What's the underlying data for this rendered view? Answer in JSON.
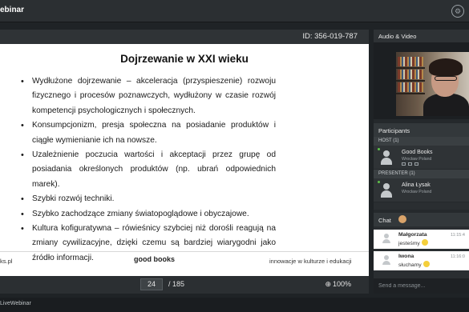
{
  "app": {
    "title": "ebinar",
    "footer_brand": "LiveWebinar"
  },
  "stage": {
    "room_id": "ID: 356-019-787",
    "slide": {
      "title": "Dojrzewanie w XXI wieku",
      "bullets": [
        "Wydłużone dojrzewanie – akceleracja (przyspieszenie) rozwoju fizycznego i procesów poznawczych, wydłużony w czasie rozwój kompetencji psychologicznych i społecznych.",
        "Konsumpcjonizm, presja społeczna na posiadanie produktów i ciągłe wymienianie ich na nowsze.",
        "Uzależnienie poczucia wartości i akceptacji przez grupę od posiadania określonych produktów (np. ubrań odpowiednich marek).",
        "Szybki rozwój techniki.",
        "Szybko zachodzące zmiany światopoglądowe i obyczajowe.",
        "Kultura kofiguratywna – rówieśnicy szybciej niż dorośli reagują na zmiany cywilizacyjne, dzięki czemu są bardziej wiarygodni jako źródło informacji."
      ],
      "footer_left": "ks.pl",
      "footer_logo": "good books",
      "footer_right": "innowacje w kulturze i edukacji"
    },
    "pager": {
      "current": "24",
      "total": "/ 185",
      "zoom": "100%"
    }
  },
  "sidebar": {
    "av_title": "Audio & Video",
    "participants_title": "Participants",
    "host_group": "HOST (1)",
    "host": {
      "name": "Good Books",
      "location": "Wrocław Poland"
    },
    "presenter_group": "PRESENTER (1)",
    "presenter": {
      "name": "Alina Łysak",
      "location": "Wrocław Poland"
    },
    "chat_title": "Chat",
    "messages": [
      {
        "name": "Małgorzata",
        "text": "jesteśmy",
        "time": "11:15:4"
      },
      {
        "name": "Iwona",
        "text": "słuchamy",
        "time": "11:16:0"
      }
    ],
    "chat_placeholder": "Send a message..."
  },
  "colors": {
    "background": "#1f2326",
    "panel": "#25292c",
    "online": "#5fc04a",
    "accent": "#3b7bc8"
  }
}
